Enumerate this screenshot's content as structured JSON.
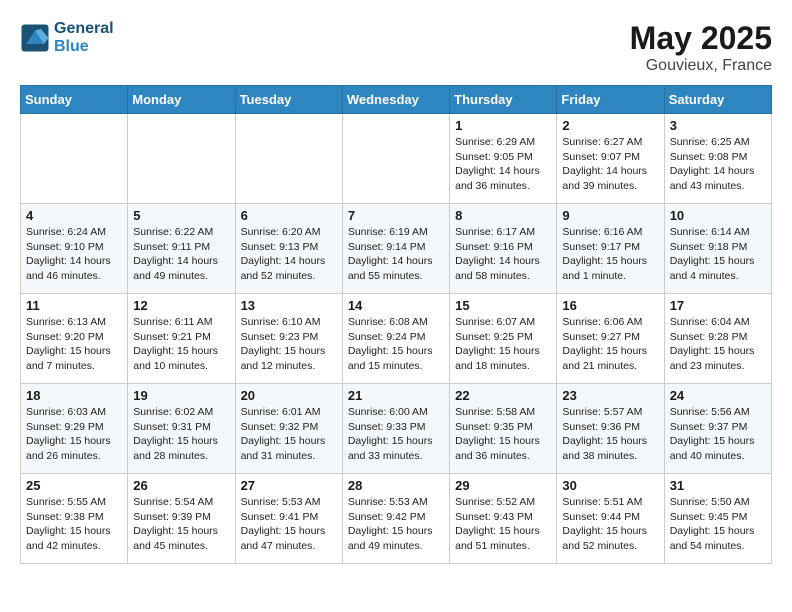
{
  "header": {
    "logo_line1": "General",
    "logo_line2": "Blue",
    "title": "May 2025",
    "subtitle": "Gouvieux, France"
  },
  "weekdays": [
    "Sunday",
    "Monday",
    "Tuesday",
    "Wednesday",
    "Thursday",
    "Friday",
    "Saturday"
  ],
  "weeks": [
    [
      {
        "day": "",
        "info": ""
      },
      {
        "day": "",
        "info": ""
      },
      {
        "day": "",
        "info": ""
      },
      {
        "day": "",
        "info": ""
      },
      {
        "day": "1",
        "info": "Sunrise: 6:29 AM\nSunset: 9:05 PM\nDaylight: 14 hours and 36 minutes."
      },
      {
        "day": "2",
        "info": "Sunrise: 6:27 AM\nSunset: 9:07 PM\nDaylight: 14 hours and 39 minutes."
      },
      {
        "day": "3",
        "info": "Sunrise: 6:25 AM\nSunset: 9:08 PM\nDaylight: 14 hours and 43 minutes."
      }
    ],
    [
      {
        "day": "4",
        "info": "Sunrise: 6:24 AM\nSunset: 9:10 PM\nDaylight: 14 hours and 46 minutes."
      },
      {
        "day": "5",
        "info": "Sunrise: 6:22 AM\nSunset: 9:11 PM\nDaylight: 14 hours and 49 minutes."
      },
      {
        "day": "6",
        "info": "Sunrise: 6:20 AM\nSunset: 9:13 PM\nDaylight: 14 hours and 52 minutes."
      },
      {
        "day": "7",
        "info": "Sunrise: 6:19 AM\nSunset: 9:14 PM\nDaylight: 14 hours and 55 minutes."
      },
      {
        "day": "8",
        "info": "Sunrise: 6:17 AM\nSunset: 9:16 PM\nDaylight: 14 hours and 58 minutes."
      },
      {
        "day": "9",
        "info": "Sunrise: 6:16 AM\nSunset: 9:17 PM\nDaylight: 15 hours and 1 minute."
      },
      {
        "day": "10",
        "info": "Sunrise: 6:14 AM\nSunset: 9:18 PM\nDaylight: 15 hours and 4 minutes."
      }
    ],
    [
      {
        "day": "11",
        "info": "Sunrise: 6:13 AM\nSunset: 9:20 PM\nDaylight: 15 hours and 7 minutes."
      },
      {
        "day": "12",
        "info": "Sunrise: 6:11 AM\nSunset: 9:21 PM\nDaylight: 15 hours and 10 minutes."
      },
      {
        "day": "13",
        "info": "Sunrise: 6:10 AM\nSunset: 9:23 PM\nDaylight: 15 hours and 12 minutes."
      },
      {
        "day": "14",
        "info": "Sunrise: 6:08 AM\nSunset: 9:24 PM\nDaylight: 15 hours and 15 minutes."
      },
      {
        "day": "15",
        "info": "Sunrise: 6:07 AM\nSunset: 9:25 PM\nDaylight: 15 hours and 18 minutes."
      },
      {
        "day": "16",
        "info": "Sunrise: 6:06 AM\nSunset: 9:27 PM\nDaylight: 15 hours and 21 minutes."
      },
      {
        "day": "17",
        "info": "Sunrise: 6:04 AM\nSunset: 9:28 PM\nDaylight: 15 hours and 23 minutes."
      }
    ],
    [
      {
        "day": "18",
        "info": "Sunrise: 6:03 AM\nSunset: 9:29 PM\nDaylight: 15 hours and 26 minutes."
      },
      {
        "day": "19",
        "info": "Sunrise: 6:02 AM\nSunset: 9:31 PM\nDaylight: 15 hours and 28 minutes."
      },
      {
        "day": "20",
        "info": "Sunrise: 6:01 AM\nSunset: 9:32 PM\nDaylight: 15 hours and 31 minutes."
      },
      {
        "day": "21",
        "info": "Sunrise: 6:00 AM\nSunset: 9:33 PM\nDaylight: 15 hours and 33 minutes."
      },
      {
        "day": "22",
        "info": "Sunrise: 5:58 AM\nSunset: 9:35 PM\nDaylight: 15 hours and 36 minutes."
      },
      {
        "day": "23",
        "info": "Sunrise: 5:57 AM\nSunset: 9:36 PM\nDaylight: 15 hours and 38 minutes."
      },
      {
        "day": "24",
        "info": "Sunrise: 5:56 AM\nSunset: 9:37 PM\nDaylight: 15 hours and 40 minutes."
      }
    ],
    [
      {
        "day": "25",
        "info": "Sunrise: 5:55 AM\nSunset: 9:38 PM\nDaylight: 15 hours and 42 minutes."
      },
      {
        "day": "26",
        "info": "Sunrise: 5:54 AM\nSunset: 9:39 PM\nDaylight: 15 hours and 45 minutes."
      },
      {
        "day": "27",
        "info": "Sunrise: 5:53 AM\nSunset: 9:41 PM\nDaylight: 15 hours and 47 minutes."
      },
      {
        "day": "28",
        "info": "Sunrise: 5:53 AM\nSunset: 9:42 PM\nDaylight: 15 hours and 49 minutes."
      },
      {
        "day": "29",
        "info": "Sunrise: 5:52 AM\nSunset: 9:43 PM\nDaylight: 15 hours and 51 minutes."
      },
      {
        "day": "30",
        "info": "Sunrise: 5:51 AM\nSunset: 9:44 PM\nDaylight: 15 hours and 52 minutes."
      },
      {
        "day": "31",
        "info": "Sunrise: 5:50 AM\nSunset: 9:45 PM\nDaylight: 15 hours and 54 minutes."
      }
    ]
  ]
}
